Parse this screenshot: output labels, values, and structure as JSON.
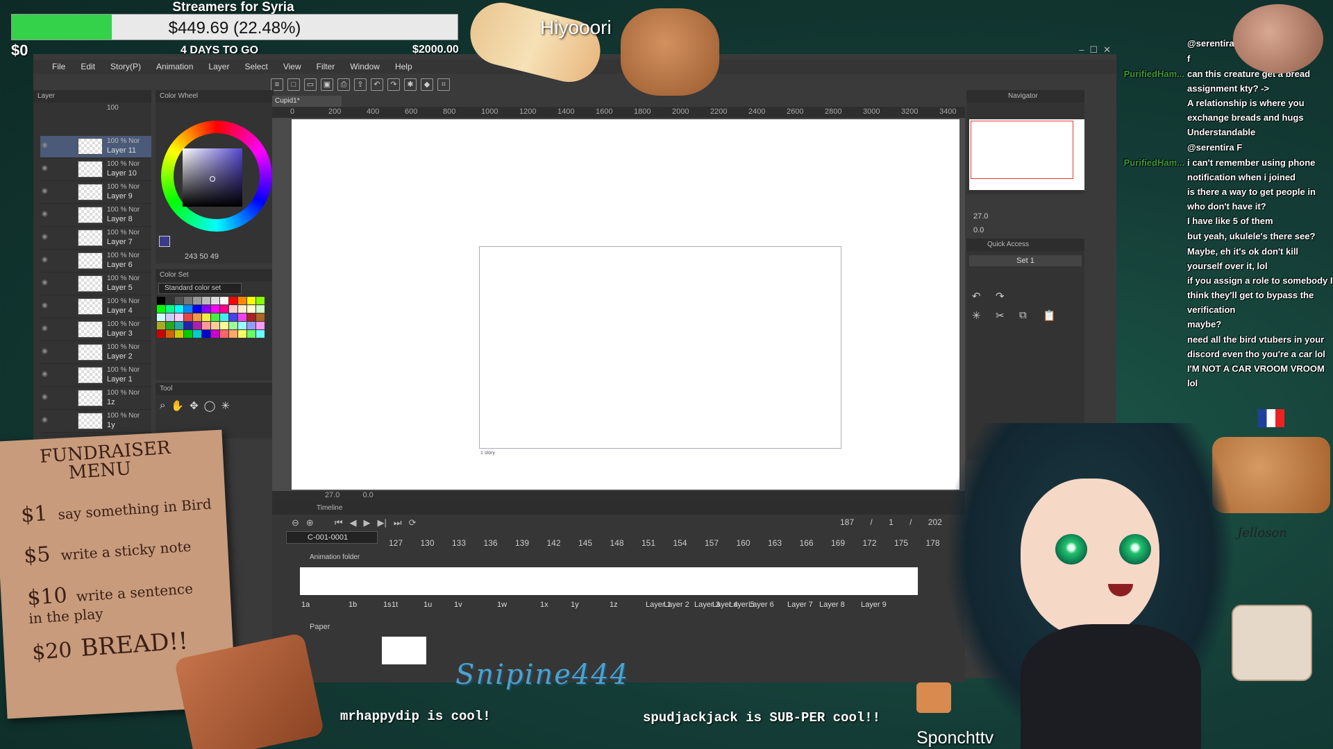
{
  "stream": {
    "donation_title": "Streamers for Syria",
    "donation_amount": "$449.69 (22.48%)",
    "donation_progress": 0.2248,
    "donation_start": "$0",
    "days_left": "4 DAYS TO GO",
    "donation_goal": "$2000.00",
    "vtuber_top": "Hiyooori",
    "vtuber_bottom": "Sponchttv",
    "bottom_left_msg": "mrhappydip is cool!",
    "bottom_right_msg": "spudjackjack is SUB-PER cool!!",
    "stream_logo": "Snipine444",
    "jelloson": "Jelloson",
    "accent_green": "#34d24a"
  },
  "fundraiser_menu": {
    "title": "FUNDRAISER MENU",
    "items": [
      {
        "price": "$1",
        "text": "say something in Bird"
      },
      {
        "price": "$5",
        "text": "write a sticky note"
      },
      {
        "price": "$10",
        "text": "write a sentence in the play"
      },
      {
        "price": "$20",
        "text": "BREAD!!"
      }
    ]
  },
  "app": {
    "menu": [
      "File",
      "Edit",
      "Story(P)",
      "Animation",
      "Layer",
      "Select",
      "View",
      "Filter",
      "Window",
      "Help"
    ],
    "canvas_tab": "Cupid1*",
    "layer_panel_title": "Layer",
    "blend_mode": "100 % Nor",
    "opacity_value": "100",
    "layers": [
      "Layer 11",
      "Layer 10",
      "Layer 9",
      "Layer 8",
      "Layer 7",
      "Layer 6",
      "Layer 5",
      "Layer 4",
      "Layer 3",
      "Layer 2",
      "Layer 1",
      "1z",
      "1y"
    ],
    "color_wheel_title": "Color Wheel",
    "color_values": "243  50  49",
    "color_set_title": "Color Set",
    "color_set_select": "Standard color set",
    "tool_title": "Tool",
    "ruler_ticks": [
      "0",
      "200",
      "400",
      "600",
      "800",
      "1000",
      "1200",
      "1400",
      "1600",
      "1800",
      "2000",
      "2200",
      "2400",
      "2600",
      "2800",
      "3000",
      "3200",
      "3400"
    ],
    "frame_label": "1 story",
    "zoom": "27.0",
    "angle": "0.0",
    "navigator_title": "Navigator",
    "nav_zoom": "27.0",
    "nav_angle": "0.0",
    "quick_access_title": "Quick Access",
    "quick_access_set": "Set 1"
  },
  "timeline": {
    "title": "Timeline",
    "track": "C-001-0001",
    "counter": [
      "187",
      "1",
      "202"
    ],
    "frame_numbers": [
      "127",
      "130",
      "133",
      "136",
      "139",
      "142",
      "145",
      "148",
      "151",
      "154",
      "157",
      "160",
      "163",
      "166",
      "169",
      "172",
      "175",
      "178"
    ],
    "folder": "Animation folder",
    "cell_labels": [
      "1a",
      "1b",
      "1s",
      "1t",
      "1u",
      "1v",
      "1w",
      "1x",
      "1y",
      "1z",
      "Layer 1",
      "Layer 2",
      "Layer 3",
      "Layer 4",
      "Layer 5",
      "Layer 6",
      "Layer 7",
      "Layer 8",
      "Layer 9"
    ],
    "paper": "Paper"
  },
  "chat": [
    {
      "user": "",
      "msg": "@serentira"
    },
    {
      "user": "",
      "msg": "f"
    },
    {
      "user": "PurifiedHam...",
      "msg": "can this creature get a bread assignment kty? ->"
    },
    {
      "user": "",
      "msg": "A relationship is where you exchange breads and hugs"
    },
    {
      "user": "",
      "msg": "Understandable"
    },
    {
      "user": "",
      "msg": "@serentira F"
    },
    {
      "user": "PurifiedHam...",
      "msg": "i can't remember using phone notification when i joined"
    },
    {
      "user": "",
      "msg": "is there a way to get people in who don't have it?"
    },
    {
      "user": "",
      "msg": "I have like 5 of them"
    },
    {
      "user": "",
      "msg": "but yeah, ukulele's there see?"
    },
    {
      "user": "",
      "msg": "Maybe, eh it's ok don't kill yourself over it, lol"
    },
    {
      "user": "",
      "msg": "if you assign a role to somebody I think they'll get to bypass the verification"
    },
    {
      "user": "",
      "msg": "maybe?"
    },
    {
      "user": "",
      "msg": "need all the bird vtubers in your discord even tho you're a car lol"
    },
    {
      "user": "",
      "msg": "I'M NOT A CAR VROOM VROOM lol"
    }
  ]
}
